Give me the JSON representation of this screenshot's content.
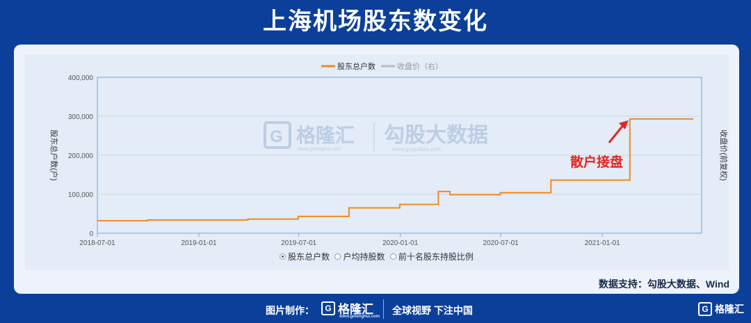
{
  "page": {
    "title": "上海机场股东数变化",
    "source_text": "数据支持：勾股大数据、Wind",
    "footer_credit": "图片制作：",
    "footer_logo": "格隆汇",
    "footer_logo_sub": "www.gelonghui.com",
    "footer_slogan": "全球视野 下注中国",
    "corner_logo": "格隆汇"
  },
  "watermark": {
    "brand1": "格隆汇",
    "brand1_url": "www.gelonghui.com",
    "brand2": "勾股大数据",
    "brand2_url": "www.gogudata.com"
  },
  "chart_data": {
    "type": "line",
    "title": "",
    "ylabel": "股东总户数(户)",
    "ylabel_right": "收盘价(前复权)",
    "ylim": [
      0,
      400000
    ],
    "yticks": [
      0,
      100000,
      200000,
      300000,
      400000
    ],
    "ytick_labels": [
      "0",
      "100,000",
      "200,000",
      "300,000",
      "400,000"
    ],
    "xlim": [
      "2018-07-01",
      "2021-06-30"
    ],
    "xticks": [
      "2018-07-01",
      "2019-01-01",
      "2019-07-01",
      "2020-01-01",
      "2020-07-01",
      "2021-01-01"
    ],
    "grid": true,
    "legend": [
      {
        "name": "股东总户数",
        "color": "#f08a24"
      },
      {
        "name": "收盘价（右）",
        "color": "#bbbbbb"
      }
    ],
    "legend_position": "top-center",
    "series": [
      {
        "name": "股东总户数",
        "color": "#f08a24",
        "step": true,
        "points": [
          [
            "2018-07-01",
            32000
          ],
          [
            "2018-09-30",
            34000
          ],
          [
            "2019-03-31",
            36000
          ],
          [
            "2019-06-30",
            43000
          ],
          [
            "2019-09-30",
            65000
          ],
          [
            "2019-12-31",
            74000
          ],
          [
            "2020-03-10",
            107000
          ],
          [
            "2020-03-31",
            99000
          ],
          [
            "2020-06-30",
            104000
          ],
          [
            "2020-09-30",
            136000
          ],
          [
            "2021-02-20",
            293000
          ],
          [
            "2021-06-15",
            293000
          ]
        ]
      }
    ],
    "annotation": {
      "text": "散户接盘",
      "color": "#e8231f",
      "x": "2021-02-20",
      "y": 293000
    },
    "radio_options": [
      {
        "label": "股东总户数",
        "selected": true
      },
      {
        "label": "户均持股数",
        "selected": false
      },
      {
        "label": "前十名股东持股比例",
        "selected": false
      }
    ]
  }
}
